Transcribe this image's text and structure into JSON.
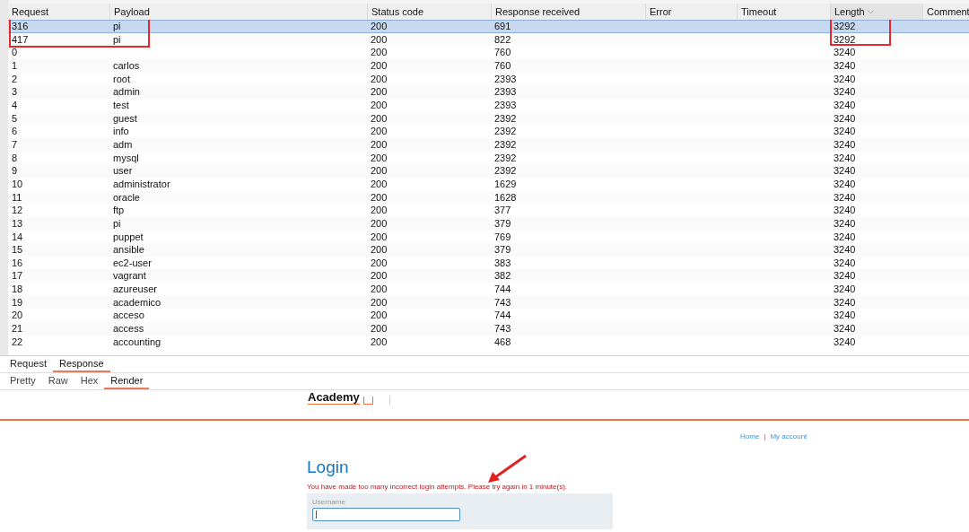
{
  "table": {
    "columns": [
      {
        "label": "Request",
        "sorted": false
      },
      {
        "label": "Payload",
        "sorted": false
      },
      {
        "label": "Status code",
        "sorted": false
      },
      {
        "label": "Response received",
        "sorted": false
      },
      {
        "label": "Error",
        "sorted": false
      },
      {
        "label": "Timeout",
        "sorted": false
      },
      {
        "label": "Length",
        "sorted": true
      },
      {
        "label": "Comment",
        "sorted": false
      }
    ],
    "rows": [
      {
        "request": "316",
        "payload": "pi",
        "status": "200",
        "received": "691",
        "length": "3292",
        "selected": true,
        "highlighted": true
      },
      {
        "request": "417",
        "payload": "pi",
        "status": "200",
        "received": "822",
        "length": "3292",
        "selected": false,
        "highlighted": true
      },
      {
        "request": "0",
        "status": "200",
        "received": "760",
        "length": "3240",
        "selected": false,
        "highlighted": false
      },
      {
        "request": "1",
        "payload": "carlos",
        "status": "200",
        "received": "760",
        "length": "3240",
        "selected": false,
        "highlighted": false
      },
      {
        "request": "2",
        "payload": "root",
        "status": "200",
        "received": "2393",
        "length": "3240",
        "selected": false,
        "highlighted": false
      },
      {
        "request": "3",
        "payload": "admin",
        "status": "200",
        "received": "2393",
        "length": "3240",
        "selected": false,
        "highlighted": false
      },
      {
        "request": "4",
        "payload": "test",
        "status": "200",
        "received": "2393",
        "length": "3240",
        "selected": false,
        "highlighted": false
      },
      {
        "request": "5",
        "payload": "guest",
        "status": "200",
        "received": "2392",
        "length": "3240",
        "selected": false,
        "highlighted": false
      },
      {
        "request": "6",
        "payload": "info",
        "status": "200",
        "received": "2392",
        "length": "3240",
        "selected": false,
        "highlighted": false
      },
      {
        "request": "7",
        "payload": "adm",
        "status": "200",
        "received": "2392",
        "length": "3240",
        "selected": false,
        "highlighted": false
      },
      {
        "request": "8",
        "payload": "mysql",
        "status": "200",
        "received": "2392",
        "length": "3240",
        "selected": false,
        "highlighted": false
      },
      {
        "request": "9",
        "payload": "user",
        "status": "200",
        "received": "2392",
        "length": "3240",
        "selected": false,
        "highlighted": false
      },
      {
        "request": "10",
        "payload": "administrator",
        "status": "200",
        "received": "1629",
        "length": "3240",
        "selected": false,
        "highlighted": false
      },
      {
        "request": "11",
        "payload": "oracle",
        "status": "200",
        "received": "1628",
        "length": "3240",
        "selected": false,
        "highlighted": false
      },
      {
        "request": "12",
        "payload": "ftp",
        "status": "200",
        "received": "377",
        "length": "3240",
        "selected": false,
        "highlighted": false
      },
      {
        "request": "13",
        "payload": "pi",
        "status": "200",
        "received": "379",
        "length": "3240",
        "selected": false,
        "highlighted": false
      },
      {
        "request": "14",
        "payload": "puppet",
        "status": "200",
        "received": "769",
        "length": "3240",
        "selected": false,
        "highlighted": false
      },
      {
        "request": "15",
        "payload": "ansible",
        "status": "200",
        "received": "379",
        "length": "3240",
        "selected": false,
        "highlighted": false
      },
      {
        "request": "16",
        "payload": "ec2-user",
        "status": "200",
        "received": "383",
        "length": "3240",
        "selected": false,
        "highlighted": false
      },
      {
        "request": "17",
        "payload": "vagrant",
        "status": "200",
        "received": "382",
        "length": "3240",
        "selected": false,
        "highlighted": false
      },
      {
        "request": "18",
        "payload": "azureuser",
        "status": "200",
        "received": "744",
        "length": "3240",
        "selected": false,
        "highlighted": false
      },
      {
        "request": "19",
        "payload": "academico",
        "status": "200",
        "received": "743",
        "length": "3240",
        "selected": false,
        "highlighted": false
      },
      {
        "request": "20",
        "payload": "acceso",
        "status": "200",
        "received": "744",
        "length": "3240",
        "selected": false,
        "highlighted": false
      },
      {
        "request": "21",
        "payload": "access",
        "status": "200",
        "received": "743",
        "length": "3240",
        "selected": false,
        "highlighted": false
      },
      {
        "request": "22",
        "payload": "accounting",
        "status": "200",
        "received": "468",
        "length": "3240",
        "selected": false,
        "highlighted": false
      }
    ]
  },
  "message_tabs": [
    {
      "label": "Request",
      "selected": false
    },
    {
      "label": "Response",
      "selected": true
    }
  ],
  "view_tabs": [
    {
      "label": "Pretty",
      "selected": false
    },
    {
      "label": "Raw",
      "selected": false
    },
    {
      "label": "Hex",
      "selected": false
    },
    {
      "label": "Render",
      "selected": true
    }
  ],
  "render": {
    "logo": "Academy",
    "nav_links": [
      "Home",
      "My account"
    ],
    "nav_separator": "|",
    "heading": "Login",
    "error": "You have made too many incorrect login attempts. Please try again in 1 minute(s).",
    "username_label": "Username"
  }
}
